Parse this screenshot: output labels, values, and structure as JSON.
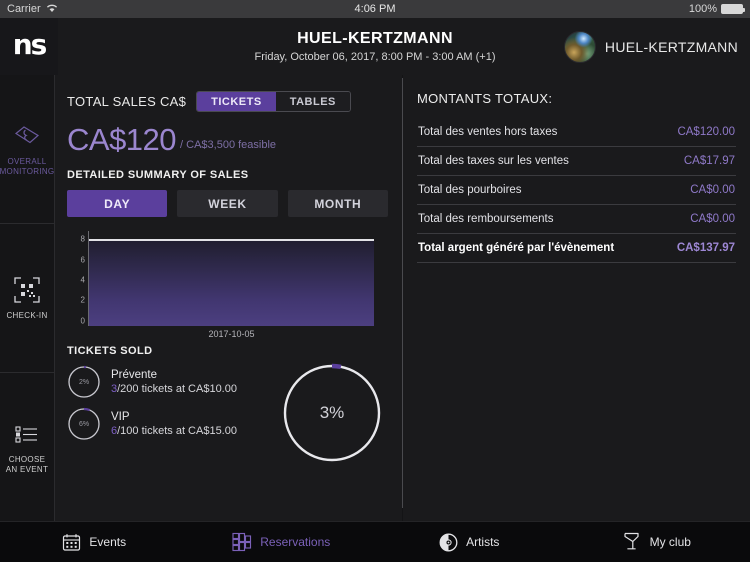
{
  "statusbar": {
    "carrier": "Carrier",
    "wifi_icon": "wifi-icon",
    "time": "4:06 PM",
    "battery_pct": "100%",
    "battery_icon": "battery-full-icon"
  },
  "header": {
    "logo": "ns",
    "title": "HUEL-KERTZMANN",
    "subtitle": "Friday, October 06, 2017, 8:00 PM - 3:00 AM (+1)",
    "club_name": "HUEL-KERTZMANN",
    "avatar_icon": "club-avatar"
  },
  "sidebar": {
    "items": [
      {
        "label": "OVERALL MONITORING",
        "icon": "ticket-icon",
        "active": true
      },
      {
        "label": "CHECK-IN",
        "icon": "qr-code-icon",
        "active": false
      },
      {
        "label": "CHOOSE AN EVENT",
        "icon": "list-icon",
        "active": false
      }
    ]
  },
  "sales": {
    "total_label": "TOTAL SALES CA$",
    "segments": [
      {
        "label": "TICKETS",
        "active": true
      },
      {
        "label": "TABLES",
        "active": false
      }
    ],
    "amount": "CA$120",
    "feasible": "/ CA$3,500 feasible",
    "detailed_title": "DETAILED SUMMARY OF SALES",
    "periods": [
      {
        "label": "DAY",
        "active": true
      },
      {
        "label": "WEEK",
        "active": false
      },
      {
        "label": "MONTH",
        "active": false
      }
    ]
  },
  "chart_data": {
    "type": "area",
    "title": "",
    "categories": [
      "2017-10-05"
    ],
    "x": [
      "2017-10-05"
    ],
    "values": [
      9
    ],
    "series": [
      {
        "name": "Sales",
        "values": [
          9
        ]
      }
    ],
    "xlabel": "2017-10-05",
    "ylabel": "",
    "ylim": [
      0,
      9
    ],
    "yticks": [
      0,
      2,
      4,
      6,
      8
    ],
    "ytick_labels": [
      "0",
      "2",
      "4",
      "6",
      "8"
    ],
    "grid": false,
    "legend": "none",
    "line_color": "#e2e2e6",
    "fill_gradient_top": "#1f1d2e",
    "fill_gradient_bottom": "#4c3f80"
  },
  "tickets": {
    "title": "TICKETS SOLD",
    "items": [
      {
        "name": "Prévente",
        "sold": "3",
        "detail": "/200 tickets at CA$10.00",
        "percent": "2%",
        "percent_value": 2
      },
      {
        "name": "VIP",
        "sold": "6",
        "detail": "/100 tickets at CA$15.00",
        "percent": "6%",
        "percent_value": 6
      }
    ],
    "donut": {
      "percent": "3%",
      "percent_value": 3,
      "arc_color": "#5b3f9d",
      "track_color": "#e8e8ec"
    }
  },
  "totals": {
    "title": "MONTANTS TOTAUX:",
    "rows": [
      {
        "label": "Total des ventes hors taxes",
        "value": "CA$120.00",
        "bold": false
      },
      {
        "label": "Total des taxes sur les ventes",
        "value": "CA$17.97",
        "bold": false
      },
      {
        "label": "Total des pourboires",
        "value": "CA$0.00",
        "bold": false
      },
      {
        "label": "Total des remboursements",
        "value": "CA$0.00",
        "bold": false
      },
      {
        "label": "Total argent généré par l'évènement",
        "value": "CA$137.97",
        "bold": true
      }
    ]
  },
  "tabbar": {
    "tabs": [
      {
        "label": "Events",
        "icon": "calendar-icon",
        "active": false
      },
      {
        "label": "Reservations",
        "icon": "table-grid-icon",
        "active": true
      },
      {
        "label": "Artists",
        "icon": "vinyl-record-icon",
        "active": false
      },
      {
        "label": "My club",
        "icon": "cocktail-glass-icon",
        "active": false
      }
    ]
  },
  "colors": {
    "accent_purple": "#5b3f9d",
    "accent_light": "#9b86cf",
    "background": "#1a1a1c"
  }
}
